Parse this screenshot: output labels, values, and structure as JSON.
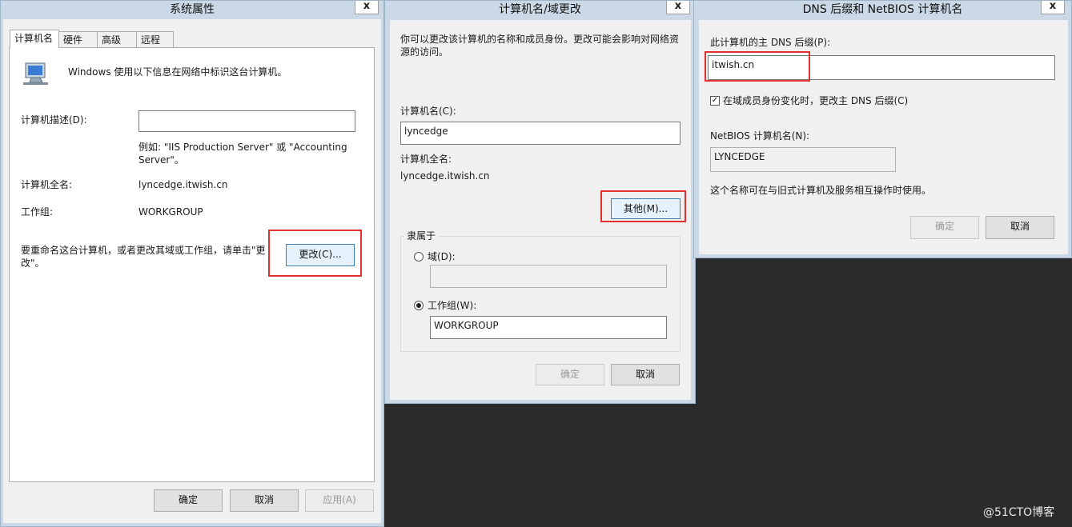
{
  "win1": {
    "title": "系统属性",
    "close": "x",
    "tabs": [
      "计算机名",
      "硬件",
      "高级",
      "远程"
    ],
    "intro": "Windows 使用以下信息在网络中标识这台计算机。",
    "desc_label": "计算机描述(D):",
    "desc_value": "",
    "example": "例如: \"IIS Production Server\" 或 \"Accounting Server\"。",
    "fullname_label": "计算机全名:",
    "fullname_value": "lyncedge.itwish.cn",
    "workgroup_label": "工作组:",
    "workgroup_value": "WORKGROUP",
    "rename_text": "要重命名这台计算机，或者更改其域或工作组，请单击\"更改\"。",
    "change_button": "更改(C)...",
    "ok": "确定",
    "cancel": "取消",
    "apply": "应用(A)"
  },
  "win2": {
    "title": "计算机名/域更改",
    "close": "x",
    "intro": "你可以更改该计算机的名称和成员身份。更改可能会影响对网络资源的访问。",
    "name_label": "计算机名(C):",
    "name_value": "lyncedge",
    "fullname_label": "计算机全名:",
    "fullname_value": "lyncedge.itwish.cn",
    "more_button": "其他(M)...",
    "member_of": "隶属于",
    "domain_label": "域(D):",
    "domain_value": "",
    "workgroup_label": "工作组(W):",
    "workgroup_value": "WORKGROUP",
    "ok": "确定",
    "cancel": "取消"
  },
  "win3": {
    "title": "DNS 后缀和 NetBIOS 计算机名",
    "close": "x",
    "suffix_label": "此计算机的主 DNS 后缀(P):",
    "suffix_value": "itwish.cn",
    "checkbox_label": "在域成员身份变化时，更改主 DNS 后缀(C)",
    "checkbox_checked": true,
    "netbios_label": "NetBIOS 计算机名(N):",
    "netbios_value": "LYNCEDGE",
    "interop_text": "这个名称可在与旧式计算机及服务相互操作时使用。",
    "ok": "确定",
    "cancel": "取消"
  },
  "watermark": "@51CTO博客",
  "colors": {
    "highlight_box": "#e03030",
    "window_frame": "#cbd9e6",
    "desktop": "#2b2b2b"
  }
}
